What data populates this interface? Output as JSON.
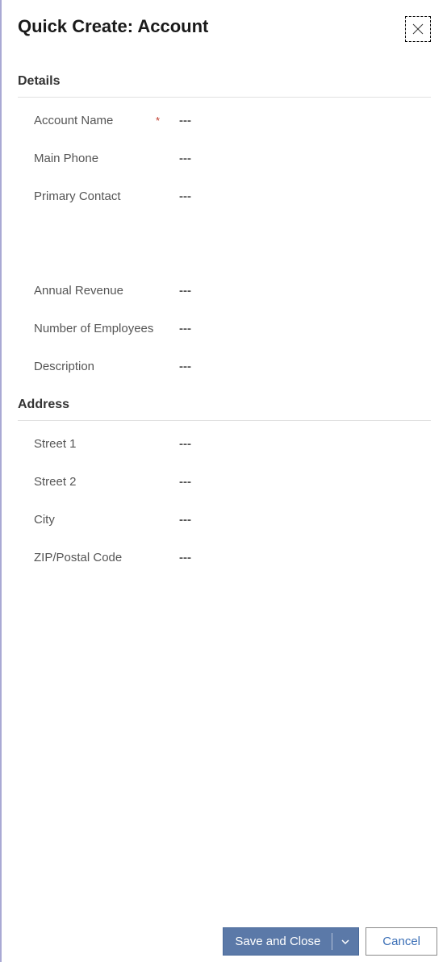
{
  "header": {
    "title": "Quick Create: Account"
  },
  "sections": {
    "details": {
      "title": "Details",
      "fields": {
        "account_name": {
          "label": "Account Name",
          "value": "---",
          "required": true
        },
        "main_phone": {
          "label": "Main Phone",
          "value": "---",
          "required": false
        },
        "primary_contact": {
          "label": "Primary Contact",
          "value": "---",
          "required": false
        },
        "annual_revenue": {
          "label": "Annual Revenue",
          "value": "---",
          "required": false
        },
        "number_of_employees": {
          "label": "Number of Employees",
          "value": "---",
          "required": false
        },
        "description": {
          "label": "Description",
          "value": "---",
          "required": false
        }
      }
    },
    "address": {
      "title": "Address",
      "fields": {
        "street1": {
          "label": "Street 1",
          "value": "---",
          "required": false
        },
        "street2": {
          "label": "Street 2",
          "value": "---",
          "required": false
        },
        "city": {
          "label": "City",
          "value": "---",
          "required": false
        },
        "zip": {
          "label": "ZIP/Postal Code",
          "value": "---",
          "required": false
        }
      }
    }
  },
  "footer": {
    "save_label": "Save and Close",
    "cancel_label": "Cancel"
  },
  "required_mark": "*"
}
